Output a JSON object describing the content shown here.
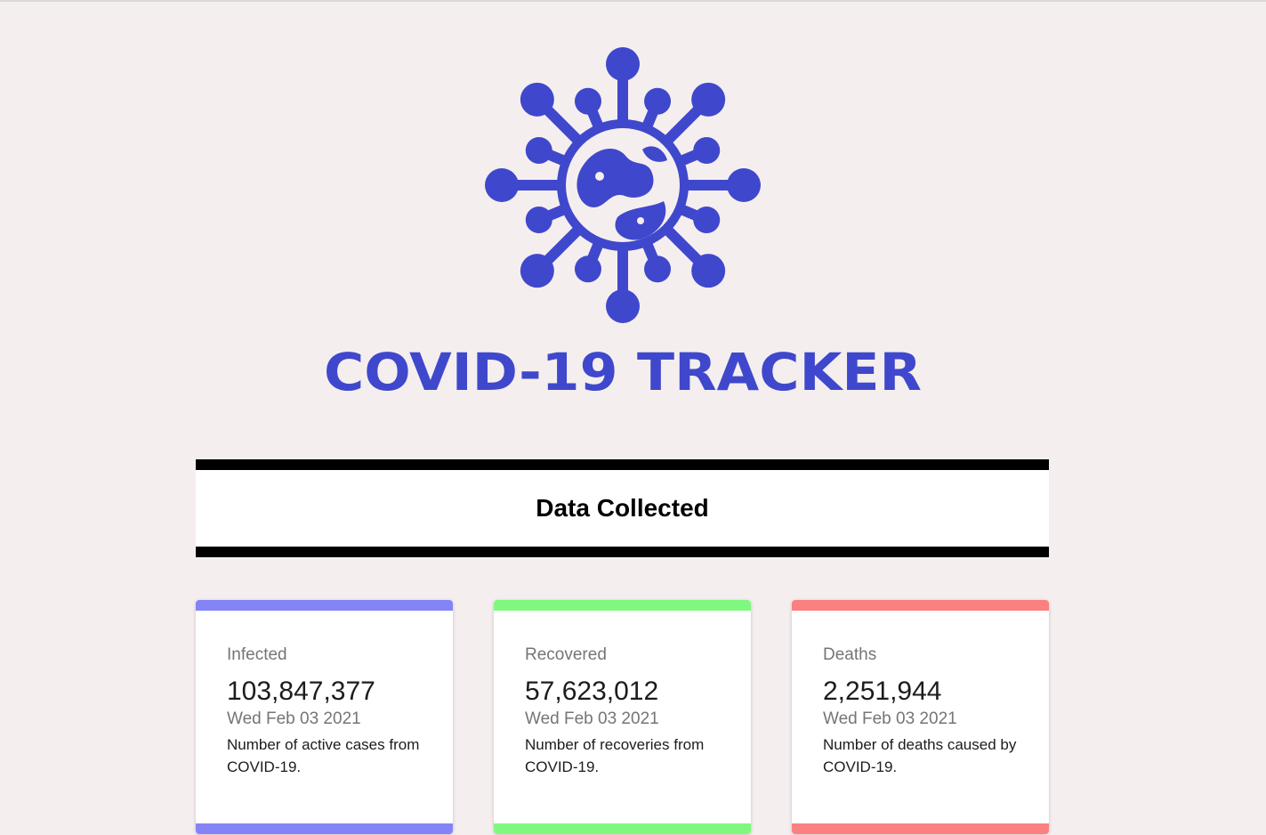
{
  "logo": {
    "icon": "virus-globe-icon",
    "text": "COVID-19 TRACKER",
    "color": "#3f48cc"
  },
  "section": {
    "title": "Data Collected"
  },
  "cards": [
    {
      "label": "Infected",
      "value": "103,847,377",
      "date": "Wed Feb 03 2021",
      "description": "Number of active cases from COVID-19.",
      "color": "#8484f7"
    },
    {
      "label": "Recovered",
      "value": "57,623,012",
      "date": "Wed Feb 03 2021",
      "description": "Number of recoveries from COVID-19.",
      "color": "#80f880"
    },
    {
      "label": "Deaths",
      "value": "2,251,944",
      "date": "Wed Feb 03 2021",
      "description": "Number of deaths caused by COVID-19.",
      "color": "#fb8080"
    }
  ]
}
